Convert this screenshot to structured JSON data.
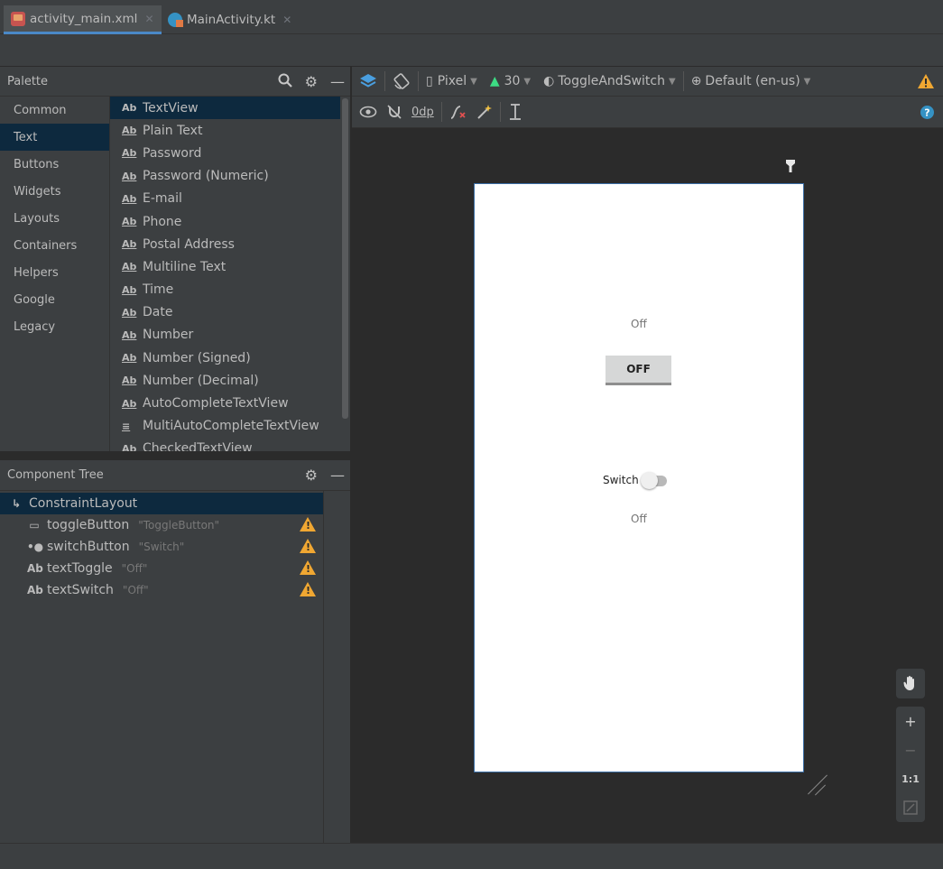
{
  "tabs": [
    {
      "label": "activity_main.xml",
      "icon": "xml-layout-icon",
      "active": true
    },
    {
      "label": "MainActivity.kt",
      "icon": "kotlin-file-icon",
      "active": false
    }
  ],
  "palette": {
    "title": "Palette",
    "categories": [
      "Common",
      "Text",
      "Buttons",
      "Widgets",
      "Layouts",
      "Containers",
      "Helpers",
      "Google",
      "Legacy"
    ],
    "selected_category": "Text",
    "items": [
      {
        "icon": "Ab",
        "label": "TextView"
      },
      {
        "icon": "Ab",
        "label": "Plain Text"
      },
      {
        "icon": "Ab",
        "label": "Password"
      },
      {
        "icon": "Ab",
        "label": "Password (Numeric)"
      },
      {
        "icon": "Ab",
        "label": "E-mail"
      },
      {
        "icon": "Ab",
        "label": "Phone"
      },
      {
        "icon": "Ab",
        "label": "Postal Address"
      },
      {
        "icon": "Ab",
        "label": "Multiline Text"
      },
      {
        "icon": "Ab",
        "label": "Time"
      },
      {
        "icon": "Ab",
        "label": "Date"
      },
      {
        "icon": "Ab",
        "label": "Number"
      },
      {
        "icon": "Ab",
        "label": "Number (Signed)"
      },
      {
        "icon": "Ab",
        "label": "Number (Decimal)"
      },
      {
        "icon": "Ab",
        "label": "AutoCompleteTextView"
      },
      {
        "icon": "≡",
        "label": "MultiAutoCompleteTextView"
      },
      {
        "icon": "Ab",
        "label": "CheckedTextView"
      }
    ]
  },
  "component_tree": {
    "title": "Component Tree",
    "root": {
      "icon": "↳",
      "label": "ConstraintLayout"
    },
    "children": [
      {
        "icon": "▭",
        "label": "toggleButton",
        "sub": "\"ToggleButton\""
      },
      {
        "icon": "•●",
        "label": "switchButton",
        "sub": "\"Switch\""
      },
      {
        "icon": "Ab",
        "label": "textToggle",
        "sub": "\"Off\""
      },
      {
        "icon": "Ab",
        "label": "textSwitch",
        "sub": "\"Off\""
      }
    ]
  },
  "design_toolbar": {
    "device": "Pixel",
    "api": "30",
    "theme": "ToggleAndSwitch",
    "locale": "Default (en-us)",
    "margin": "0dp"
  },
  "preview": {
    "text_toggle": "Off",
    "toggle_button": "OFF",
    "switch_label": "Switch",
    "text_switch": "Off"
  },
  "zoom": {
    "plus": "+",
    "minus": "−",
    "one_to_one": "1:1"
  },
  "colors": {
    "accent": "#4a88c7",
    "warning": "#f0a732",
    "selection": "#0d293e"
  }
}
